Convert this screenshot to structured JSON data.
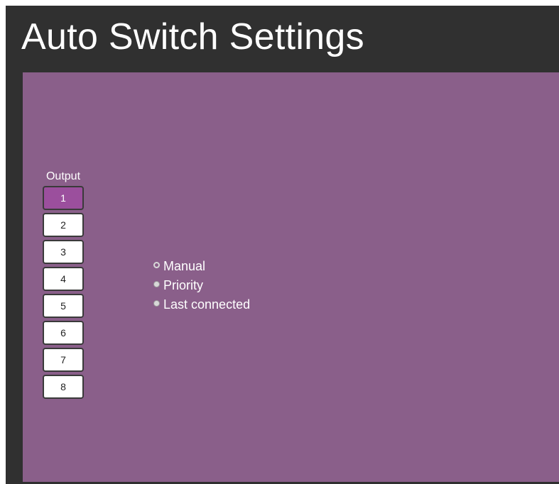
{
  "page": {
    "title": "Auto Switch Settings"
  },
  "output": {
    "label": "Output",
    "buttons": [
      {
        "label": "1",
        "active": true
      },
      {
        "label": "2",
        "active": false
      },
      {
        "label": "3",
        "active": false
      },
      {
        "label": "4",
        "active": false
      },
      {
        "label": "5",
        "active": false
      },
      {
        "label": "6",
        "active": false
      },
      {
        "label": "7",
        "active": false
      },
      {
        "label": "8",
        "active": false
      }
    ]
  },
  "mode": {
    "options": [
      {
        "label": "Manual",
        "selected": true
      },
      {
        "label": "Priority",
        "selected": false
      },
      {
        "label": "Last connected",
        "selected": false
      }
    ]
  },
  "colors": {
    "frame": "#303030",
    "panel": "#8a5f8a",
    "active_button": "#9b4f9d",
    "text": "#ffffff"
  }
}
